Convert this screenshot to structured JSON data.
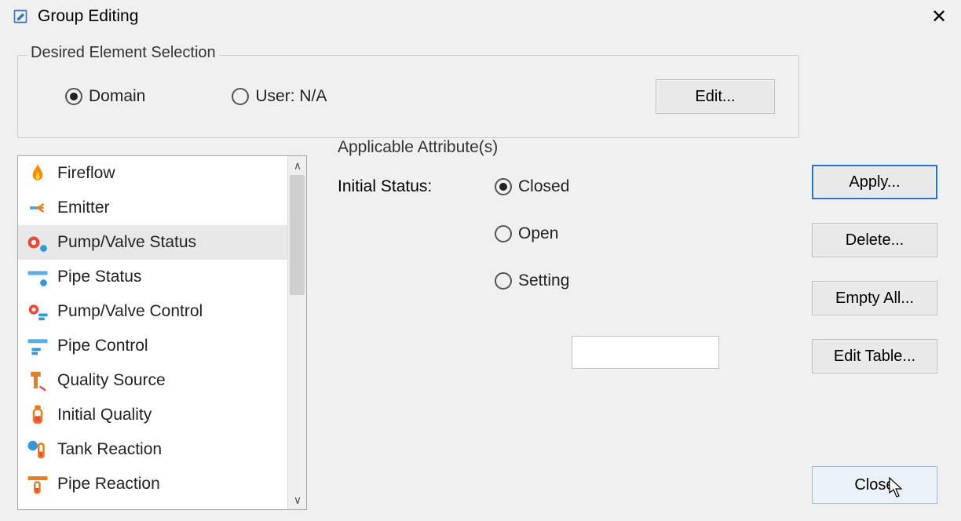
{
  "window": {
    "title": "Group Editing"
  },
  "groupbox": {
    "legend": "Desired Element Selection",
    "radio_domain": "Domain",
    "radio_user": "User: N/A",
    "edit_button": "Edit..."
  },
  "list": {
    "items": [
      {
        "label": "Fireflow",
        "icon": "fire-icon"
      },
      {
        "label": "Emitter",
        "icon": "emitter-icon"
      },
      {
        "label": "Pump/Valve Status",
        "icon": "pumpvalve-status-icon",
        "selected": true
      },
      {
        "label": "Pipe Status",
        "icon": "pipe-status-icon"
      },
      {
        "label": "Pump/Valve Control",
        "icon": "pumpvalve-control-icon"
      },
      {
        "label": "Pipe Control",
        "icon": "pipe-control-icon"
      },
      {
        "label": "Quality Source",
        "icon": "quality-source-icon"
      },
      {
        "label": "Initial Quality",
        "icon": "initial-quality-icon"
      },
      {
        "label": "Tank Reaction",
        "icon": "tank-reaction-icon"
      },
      {
        "label": "Pipe Reaction",
        "icon": "pipe-reaction-icon"
      }
    ]
  },
  "attributes": {
    "heading": "Applicable Attribute(s)",
    "label_initial_status": "Initial Status:",
    "opt_closed": "Closed",
    "opt_open": "Open",
    "opt_setting": "Setting",
    "setting_value": ""
  },
  "buttons": {
    "apply": "Apply...",
    "delete": "Delete...",
    "empty_all": "Empty All...",
    "edit_table": "Edit Table...",
    "close": "Close"
  }
}
